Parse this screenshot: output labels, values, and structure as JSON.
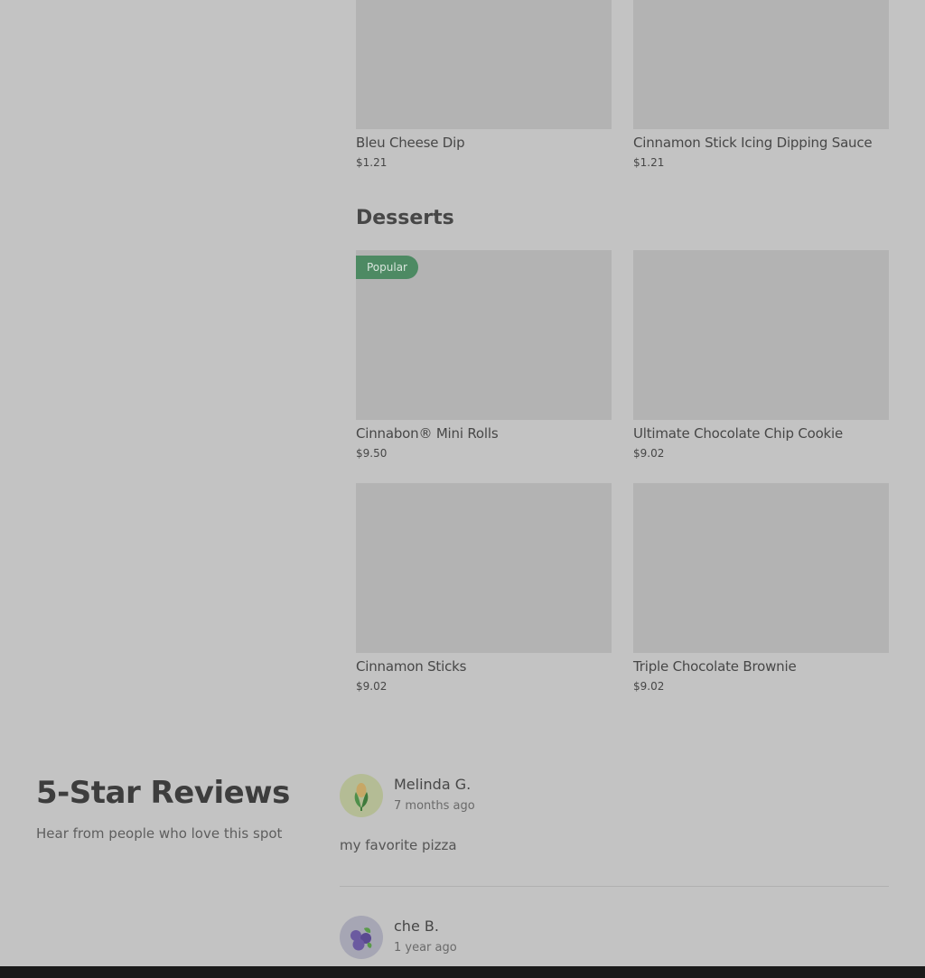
{
  "menu": {
    "sections": [
      {
        "title": "",
        "items": [
          {
            "name": "Bleu Cheese Dip",
            "price": "$1.21"
          },
          {
            "name": "Cinnamon Stick Icing Dipping Sauce",
            "price": "$1.21"
          }
        ]
      },
      {
        "title": "Desserts",
        "items": [
          {
            "name": "Cinnabon® Mini Rolls",
            "price": "$9.50",
            "badge": "Popular"
          },
          {
            "name": "Ultimate Chocolate Chip Cookie",
            "price": "$9.02"
          },
          {
            "name": "Cinnamon Sticks",
            "price": "$9.02"
          },
          {
            "name": "Triple Chocolate Brownie",
            "price": "$9.02"
          }
        ]
      }
    ]
  },
  "reviews": {
    "title": "5-Star Reviews",
    "subtitle": "Hear from people who love this spot",
    "items": [
      {
        "name": "Melinda G.",
        "time": "7 months ago",
        "text": "my favorite pizza",
        "avatar": "corn-icon"
      },
      {
        "name": "che B.",
        "time": "1 year ago",
        "text": "",
        "avatar": "berries-icon"
      }
    ]
  },
  "colors": {
    "badge": "#4d8a63",
    "page_overlay": "#c3c3c3",
    "image_placeholder": "#b3b3b3"
  }
}
